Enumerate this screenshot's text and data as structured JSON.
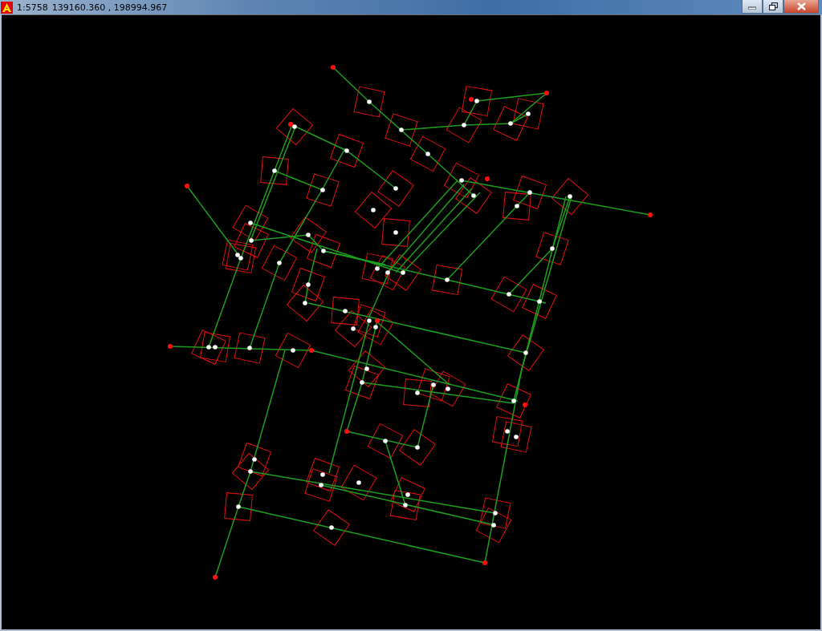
{
  "window": {
    "scale": "1:5758",
    "coordinates": "139160.360 , 198994.967"
  }
}
